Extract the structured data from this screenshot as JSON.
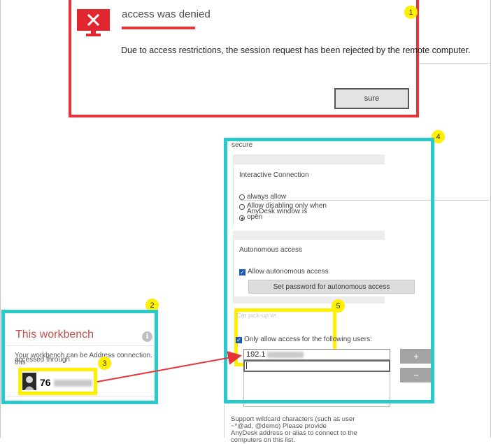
{
  "dialog": {
    "title": "access was denied",
    "message": "Due to access restrictions, the session request has been rejected by the remote computer.",
    "button_label": "sure",
    "badge": "1"
  },
  "workbench": {
    "badge": "2",
    "title": "This workbench",
    "description": "Your workbench can be    Address connection.",
    "description_overlay": "accessed through",
    "description_tail": "this",
    "id_badge": "3",
    "id_value": "76"
  },
  "settings": {
    "badge": "4",
    "section_title": "secure",
    "interactive": {
      "title": "Interactive Connection",
      "options": [
        "always allow",
        "Allow disabling only when",
        "AnyDesk window is",
        "open"
      ]
    },
    "autonomous": {
      "title": "Autonomous access",
      "checkbox_label": "Allow autonomous access",
      "password_button": "Set password for autonomous access"
    },
    "access_list": {
      "badge": "5",
      "title": "Car pick-up wi",
      "checkbox_label": "Only allow access for the following users:",
      "entry": "192.1",
      "plus": "+",
      "minus": "−"
    },
    "footnote": {
      "line1": "Support wildcard characters (such as user",
      "line2": "~*@ad,  @demo)    Please provide",
      "line3": "AnyDesk address or alias to connect to the",
      "line4": "computers on this list."
    }
  },
  "colors": {
    "red_highlight": "#e8333a",
    "cyan_highlight": "#2cc9cc",
    "yellow_highlight": "#ffef00",
    "arrow": "#e8333a"
  }
}
